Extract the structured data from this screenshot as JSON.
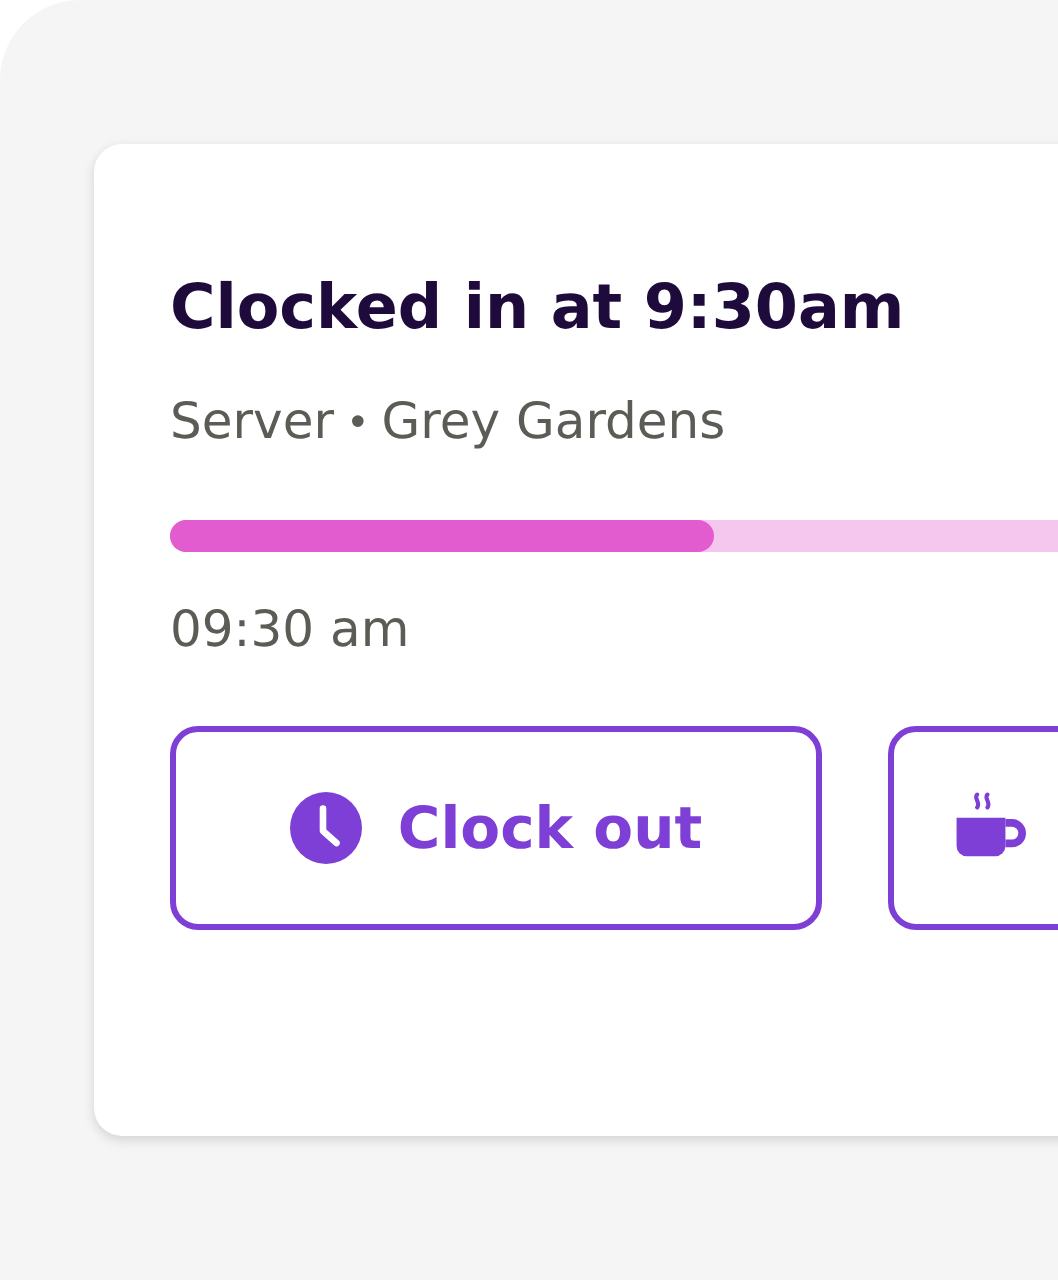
{
  "card": {
    "title": "Clocked in at 9:30am",
    "role": "Server",
    "separator": "•",
    "location": "Grey Gardens",
    "progress": {
      "level": 0.5
    },
    "start_time": "09:30 am"
  },
  "buttons": [
    {
      "kind": "clock",
      "label": "Clock out"
    },
    {
      "kind": "coffee"
    }
  ]
}
